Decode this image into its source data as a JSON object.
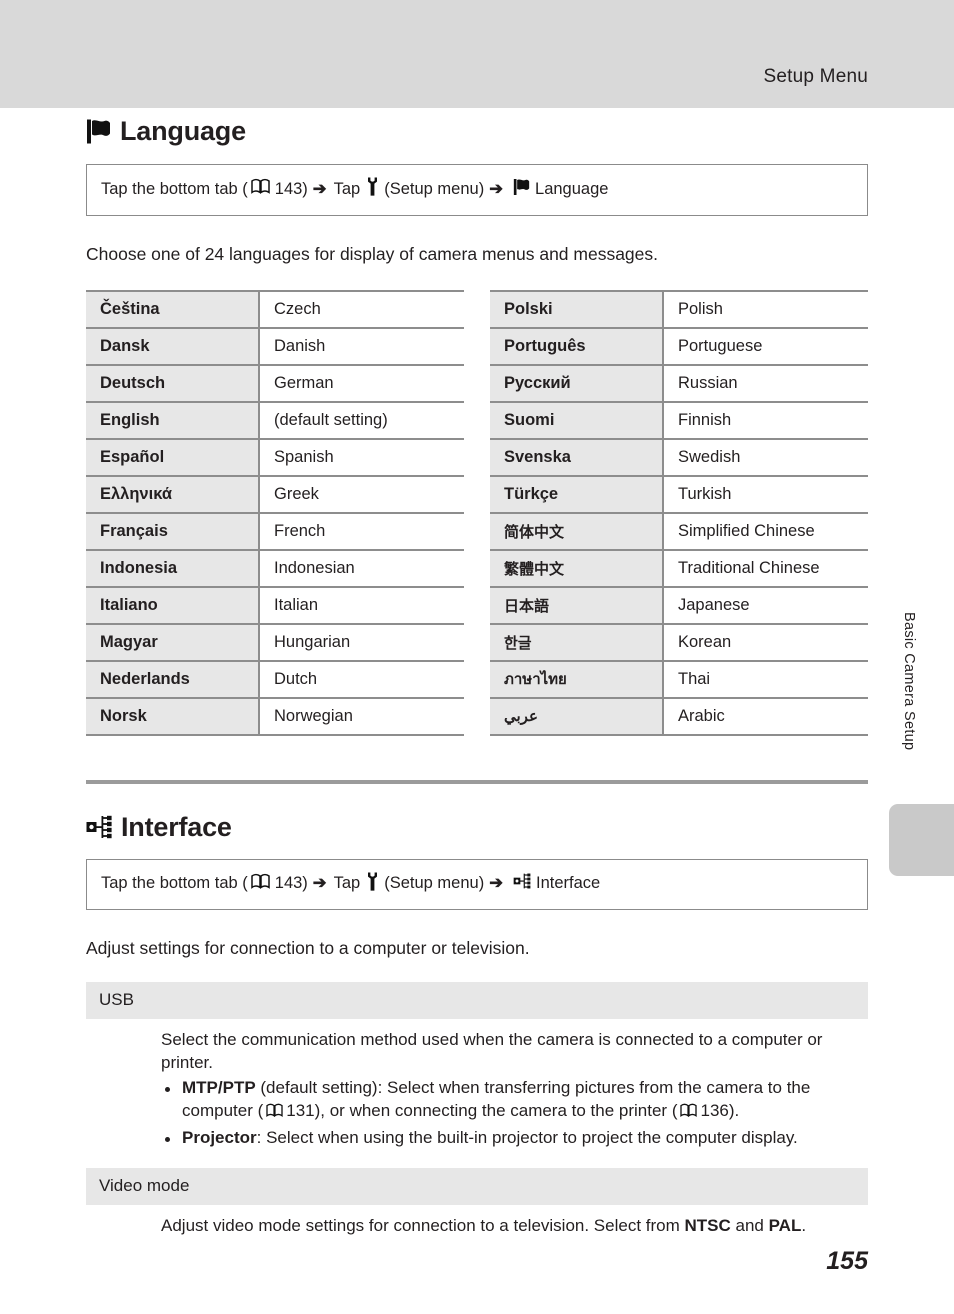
{
  "header": {
    "title": "Setup Menu"
  },
  "side_tab": {
    "label": "Basic Camera Setup"
  },
  "folio": {
    "page_number": "155"
  },
  "sections": [
    {
      "id": "language",
      "icon": "flag-language-icon",
      "title": "Language",
      "navbox": {
        "part1": "Tap the bottom tab (",
        "book_icon": "book-icon",
        "page_ref": "143",
        "part2": ")",
        "arrow1": "➔",
        "part3": "Tap",
        "wrench_icon": "wrench-setup-icon",
        "part4": "(Setup menu)",
        "arrow2": "➔",
        "target_icon": "flag-language-icon",
        "target": "Language"
      },
      "intro": "Choose one of 24 languages for display of camera menus and messages.",
      "language_columns": [
        {
          "rows": [
            {
              "native": "Čeština",
              "english": "Czech"
            },
            {
              "native": "Dansk",
              "english": "Danish"
            },
            {
              "native": "Deutsch",
              "english": "German"
            },
            {
              "native": "English",
              "english": "(default setting)"
            },
            {
              "native": "Español",
              "english": "Spanish"
            },
            {
              "native": "Ελληνικά",
              "english": "Greek"
            },
            {
              "native": "Français",
              "english": "French"
            },
            {
              "native": "Indonesia",
              "english": "Indonesian"
            },
            {
              "native": "Italiano",
              "english": "Italian"
            },
            {
              "native": "Magyar",
              "english": "Hungarian"
            },
            {
              "native": "Nederlands",
              "english": "Dutch"
            },
            {
              "native": "Norsk",
              "english": "Norwegian"
            }
          ]
        },
        {
          "rows": [
            {
              "native": "Polski",
              "english": "Polish"
            },
            {
              "native": "Português",
              "english": "Portuguese"
            },
            {
              "native": "Русский",
              "english": "Russian"
            },
            {
              "native": "Suomi",
              "english": "Finnish"
            },
            {
              "native": "Svenska",
              "english": "Swedish"
            },
            {
              "native": "Türkçe",
              "english": "Turkish"
            },
            {
              "native": "简体中文",
              "english": "Simplified Chinese"
            },
            {
              "native": "繁體中文",
              "english": "Traditional Chinese"
            },
            {
              "native": "日本語",
              "english": "Japanese"
            },
            {
              "native": "한글",
              "english": "Korean"
            },
            {
              "native": "ภาษาไทย",
              "english": "Thai"
            },
            {
              "native": "عربي",
              "english": "Arabic"
            }
          ]
        }
      ]
    },
    {
      "id": "interface",
      "icon": "interface-usb-icon",
      "title": "Interface",
      "navbox": {
        "part1": "Tap the bottom tab (",
        "book_icon": "book-icon",
        "page_ref": "143",
        "part2": ")",
        "arrow1": "➔",
        "part3": "Tap",
        "wrench_icon": "wrench-setup-icon",
        "part4": "(Setup menu)",
        "arrow2": "➔",
        "target_icon": "interface-usb-icon",
        "target": "Interface"
      },
      "intro": "Adjust settings for connection to a computer or television.",
      "settings": [
        {
          "name": "USB",
          "body_intro": "Select the communication method used when the camera is connected to a computer or printer.",
          "bullets": [
            {
              "term": "MTP/PTP",
              "text_before_ref1": " (default setting): Select when transferring pictures from the camera to the computer (",
              "ref1": "131",
              "text_between": "), or when connecting the camera to the printer (",
              "ref2": "136",
              "text_after": ")."
            },
            {
              "term": "Projector",
              "text_plain": ": Select when using the built-in projector to project the computer display."
            }
          ]
        },
        {
          "name": "Video mode",
          "body_parts": {
            "p1": "Adjust video mode settings for connection to a television. Select from ",
            "b1": "NTSC",
            "p2": " and ",
            "b2": "PAL",
            "p3": "."
          }
        }
      ]
    }
  ]
}
